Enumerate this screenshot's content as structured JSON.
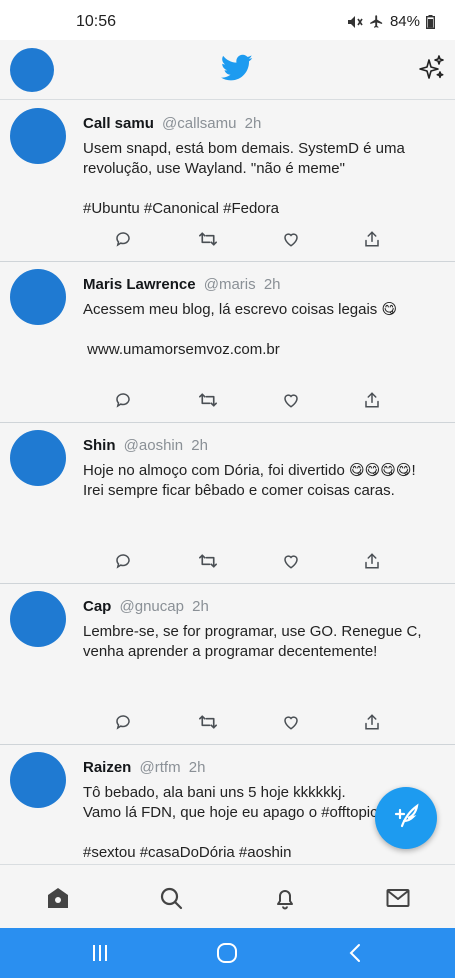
{
  "status_bar": {
    "time": "10:56",
    "battery": "84%",
    "icons": [
      "mute-icon",
      "airplane-mode-icon",
      "battery-icon"
    ]
  },
  "header": {
    "logo": "twitter-bird-icon",
    "sparkle": "sparkle-icon"
  },
  "colors": {
    "accent": "#1d9bf0",
    "avatar": "#1f7ad2",
    "system_nav": "#2a8ff0",
    "text_secondary": "#8a9096"
  },
  "tweets": [
    {
      "name": "Call samu",
      "handle": "@callsamu",
      "time": "2h",
      "body": "Usem snapd, está bom demais. SystemD é uma\nrevolução, use Wayland. \"não é meme\"\n\n#Ubuntu #Canonical #Fedora"
    },
    {
      "name": "Maris Lawrence",
      "handle": "@maris",
      "time": "2h",
      "body": "Acessem meu blog, lá escrevo coisas legais 😋\n\n www.umamorsemvoz.com.br"
    },
    {
      "name": "Shin",
      "handle": "@aoshin",
      "time": "2h",
      "body": "Hoje no almoço com Dória, foi divertido 😋😋😋😋!\nIrei sempre ficar bêbado e comer coisas caras."
    },
    {
      "name": "Cap",
      "handle": "@gnucap",
      "time": "2h",
      "body": "Lembre-se, se for programar, use GO. Renegue C,\nvenha aprender a programar decentemente!"
    },
    {
      "name": "Raizen",
      "handle": "@rtfm",
      "time": "2h",
      "body": "Tô bebado, ala bani uns 5 hoje kkkkkkj.\nVamo lá FDN, que hoje eu apago o #offtopic\n\n#sextou #casaDoDória #aoshin"
    }
  ],
  "tweet_actions": [
    "reply-icon",
    "retweet-icon",
    "like-icon",
    "share-icon"
  ],
  "fab": {
    "icon": "compose-tweet-icon"
  },
  "bottom_nav": [
    "home-icon",
    "search-icon",
    "notifications-icon",
    "messages-icon"
  ],
  "system_nav": [
    "recent-apps-icon",
    "home-circle-icon",
    "back-icon"
  ]
}
